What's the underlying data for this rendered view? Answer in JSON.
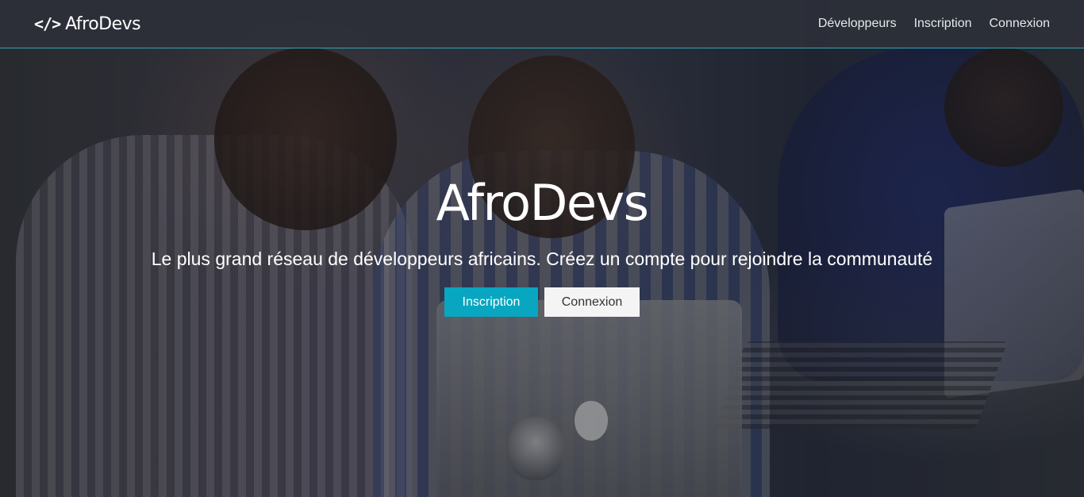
{
  "navbar": {
    "brand_icon": "</>",
    "brand_name": "AfroDevs",
    "links": [
      {
        "label": "Développeurs"
      },
      {
        "label": "Inscription"
      },
      {
        "label": "Connexion"
      }
    ]
  },
  "hero": {
    "title": "AfroDevs",
    "subtitle": "Le plus grand réseau de développeurs africains. Créez un compte pour rejoindre la communauté",
    "buttons": {
      "primary_label": "Inscription",
      "secondary_label": "Connexion"
    }
  },
  "colors": {
    "accent": "#08a6c0",
    "navbar_bg": "#2c3038",
    "navbar_border": "#2fa9b4"
  },
  "icons": {
    "brand": "code-icon",
    "background": "hero-photo"
  }
}
